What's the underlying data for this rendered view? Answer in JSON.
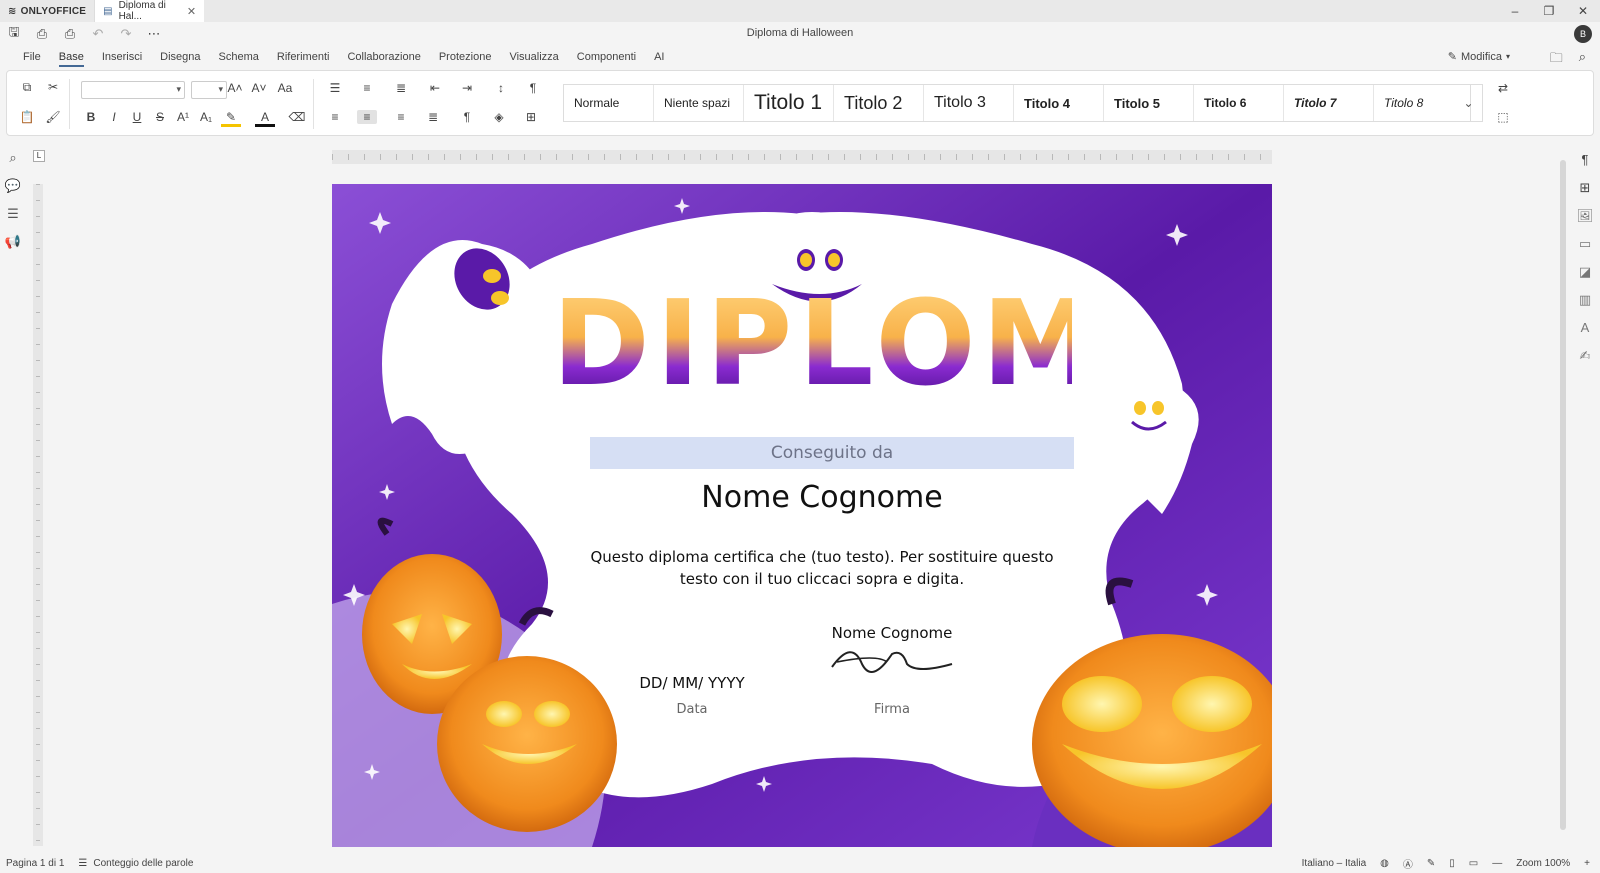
{
  "app": {
    "brand": "ONLYOFFICE",
    "tab_title": "Diploma di Hal...",
    "doc_title": "Diploma di Halloween",
    "avatar": "B"
  },
  "window_controls": {
    "minimize": "–",
    "restore": "❐",
    "close": "✕"
  },
  "menu": {
    "items": [
      "File",
      "Base",
      "Inserisci",
      "Disegna",
      "Schema",
      "Riferimenti",
      "Collaborazione",
      "Protezione",
      "Visualizza",
      "Componenti",
      "AI"
    ],
    "active": "Base"
  },
  "mode": {
    "label": "Modifica"
  },
  "styles": [
    "Normale",
    "Niente spazi",
    "Titolo 1",
    "Titolo 2",
    "Titolo 3",
    "Titolo 4",
    "Titolo 5",
    "Titolo 6",
    "Titolo 7",
    "Titolo 8"
  ],
  "document": {
    "heading": "DIPLOMA",
    "awarded": "Conseguito da",
    "name": "Nome Cognome",
    "body_line1": "Questo diploma certifica che (tuo testo). Per sostituire questo",
    "body_line2": "testo con il tuo cliccaci sopra  e digita.",
    "signer_name": "Nome Cognome",
    "date_value": "DD/ MM/ YYYY",
    "date_label": "Data",
    "signature_label": "Firma"
  },
  "status": {
    "page": "Pagina 1 di 1",
    "word_count": "Conteggio delle parole",
    "language": "Italiano – Italia",
    "zoom": "Zoom 100%"
  }
}
